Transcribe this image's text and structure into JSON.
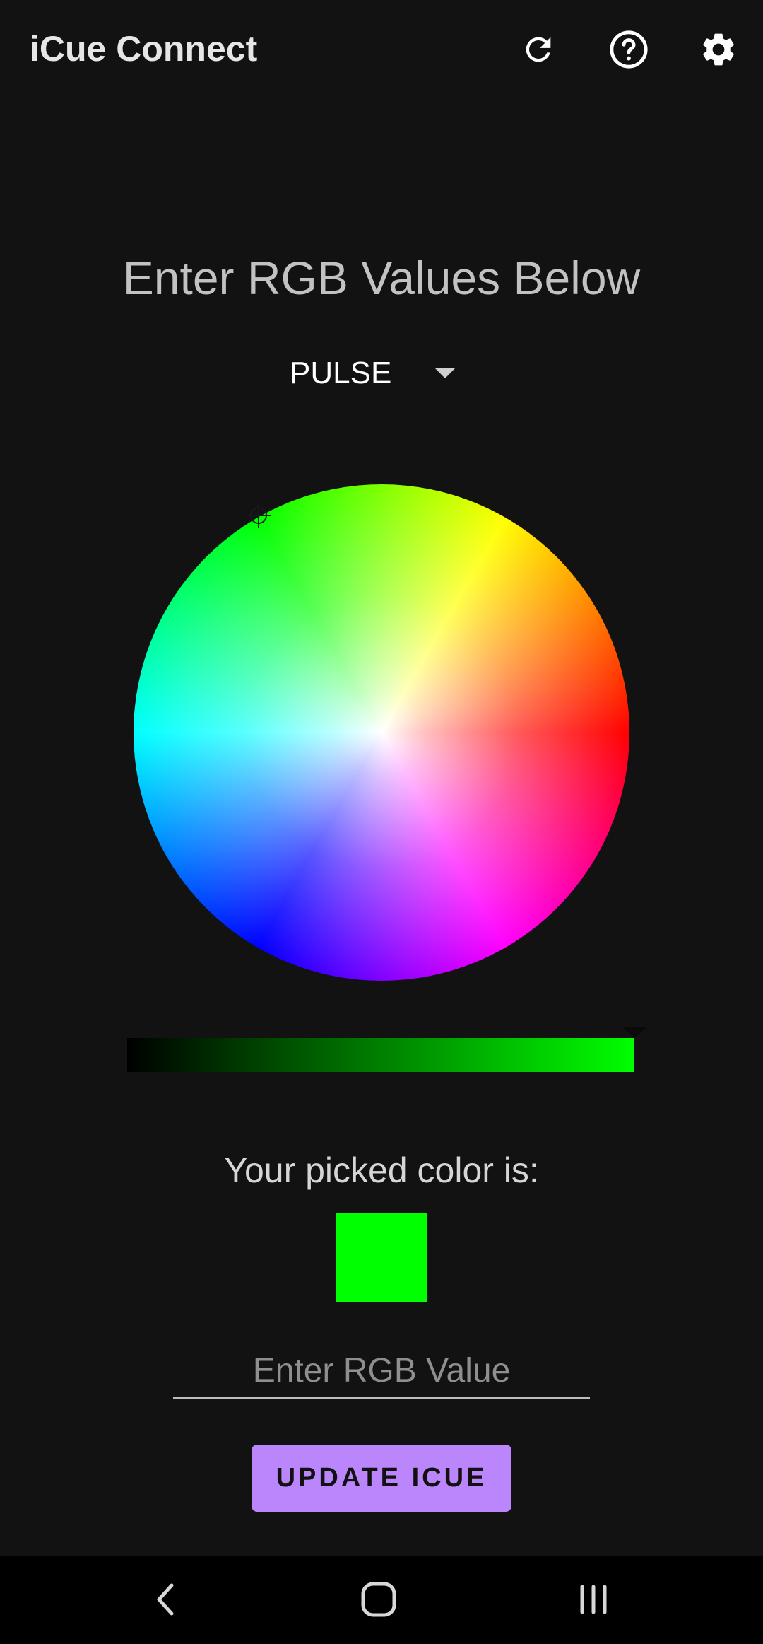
{
  "app_bar": {
    "title": "iCue Connect",
    "icons": [
      "refresh-icon",
      "help-icon",
      "settings-icon"
    ]
  },
  "heading": "Enter RGB Values Below",
  "mode_dropdown": {
    "selected": "PULSE"
  },
  "picker": {
    "picked_label": "Your picked color is:",
    "picked_color": "#00ff00",
    "brightness": 1.0
  },
  "rgb_input": {
    "value": "",
    "placeholder": "Enter RGB Value"
  },
  "update_button": {
    "label": "UPDATE ICUE",
    "color": "#bb86fc"
  },
  "nav_bar": {
    "icons": [
      "back-icon",
      "home-icon",
      "recent-apps-icon"
    ]
  }
}
